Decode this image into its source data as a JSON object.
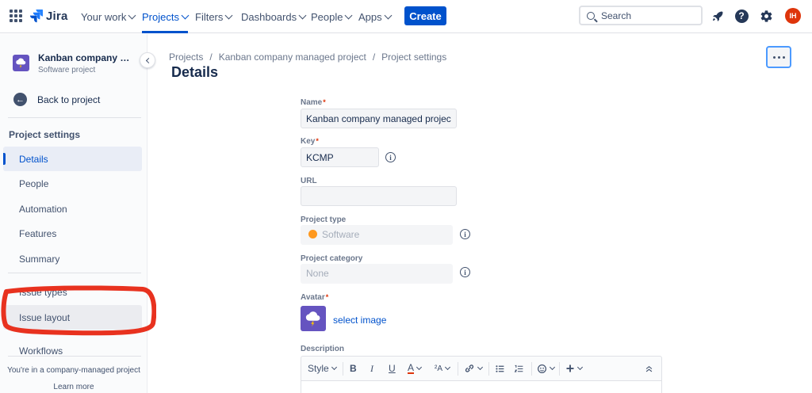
{
  "nav": {
    "logo": "Jira",
    "items": [
      {
        "label": "Your work"
      },
      {
        "label": "Projects"
      },
      {
        "label": "Filters"
      },
      {
        "label": "Dashboards"
      },
      {
        "label": "People"
      },
      {
        "label": "Apps"
      }
    ],
    "create_label": "Create",
    "search_placeholder": "Search",
    "avatar_initials": "IH",
    "help_glyph": "?",
    "accent": "#0052cc",
    "icons": [
      "apps-grid-icon",
      "notification-icon",
      "help-icon",
      "settings-icon"
    ]
  },
  "sidebar": {
    "project_name": "Kanban company managed project",
    "project_type": "Software project",
    "back_label": "Back to project",
    "section_title": "Project settings",
    "items": [
      {
        "label": "Details"
      },
      {
        "label": "People"
      },
      {
        "label": "Automation"
      },
      {
        "label": "Features"
      },
      {
        "label": "Summary"
      },
      {
        "label": "Issue types"
      },
      {
        "label": "Issue layout"
      },
      {
        "label": "Workflows"
      }
    ],
    "footer_text": "You're in a company-managed project",
    "learn_more": "Learn more"
  },
  "main": {
    "breadcrumb": [
      "Projects",
      "Kanban company managed project",
      "Project settings"
    ],
    "breadcrumb_sep": "/",
    "title": "Details",
    "fields": {
      "name_label": "Name",
      "name_value": "Kanban company managed project",
      "key_label": "Key",
      "key_value": "KCMP",
      "url_label": "URL",
      "url_value": "",
      "type_label": "Project type",
      "type_value": "Software",
      "category_label": "Project category",
      "category_value": "None",
      "avatar_label": "Avatar",
      "select_image": "select image",
      "description_label": "Description",
      "required_mark": "*",
      "info_glyph": "i"
    },
    "toolbar": {
      "style_label": "Style",
      "bold": "B",
      "italic": "I",
      "underline": "U",
      "text_color": "A",
      "text_size": "²A"
    }
  }
}
